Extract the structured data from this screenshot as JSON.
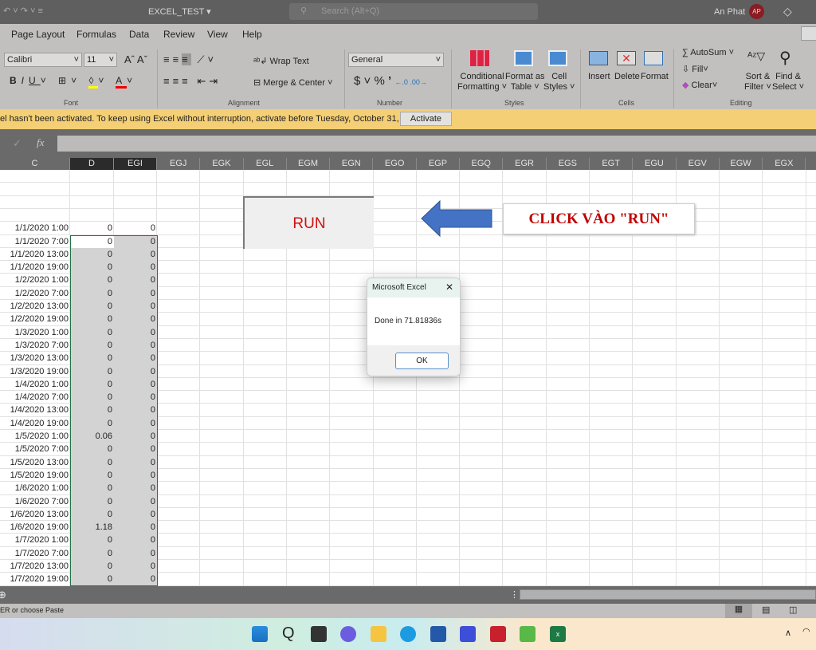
{
  "titlebar": {
    "filename": "EXCEL_TEST ▾",
    "search_placeholder": "Search (Alt+Q)",
    "user": "An Phat",
    "avatar": "AP"
  },
  "ribbon": {
    "tabs": [
      "Page Layout",
      "Formulas",
      "Data",
      "Review",
      "View",
      "Help"
    ],
    "font": {
      "name": "Calibri",
      "size": "11",
      "group": "Font"
    },
    "alignment": {
      "wrap": "Wrap Text",
      "merge": "Merge & Center",
      "group": "Alignment"
    },
    "number": {
      "format": "General",
      "group": "Number",
      "currency": "$",
      "percent": "%",
      "comma": "’"
    },
    "styles": {
      "conditional": [
        "Conditional",
        "Formatting ˅"
      ],
      "table": [
        "Format as",
        "Table ˅"
      ],
      "cell": [
        "Cell",
        "Styles ˅"
      ],
      "group": "Styles"
    },
    "cells": {
      "insert": "Insert",
      "delete": "Delete",
      "format": "Format",
      "group": "Cells"
    },
    "editing": {
      "autosum": "AutoSum",
      "fill": "Fill",
      "clear": "Clear",
      "sort": [
        "Sort &",
        "Filter ˅"
      ],
      "find": [
        "Find &",
        "Select ˅"
      ],
      "group": "Editing"
    }
  },
  "notice": {
    "text": "el hasn't been activated. To keep using Excel without interruption, activate before Tuesday, October 31, 2023.",
    "button": "Activate"
  },
  "formula_bar": {
    "fx": "fx",
    "check": "✓"
  },
  "columns": [
    "C",
    "D",
    "EGI",
    "EGJ",
    "EGK",
    "EGL",
    "EGM",
    "EGN",
    "EGO",
    "EGP",
    "EGQ",
    "EGR",
    "EGS",
    "EGT",
    "EGU",
    "EGV",
    "EGW",
    "EGX"
  ],
  "rows": [
    [
      "1/1/2020 1:00",
      "0",
      "0"
    ],
    [
      "1/1/2020 7:00",
      "0",
      "0"
    ],
    [
      "1/1/2020 13:00",
      "0",
      "0"
    ],
    [
      "1/1/2020 19:00",
      "0",
      "0"
    ],
    [
      "1/2/2020 1:00",
      "0",
      "0"
    ],
    [
      "1/2/2020 7:00",
      "0",
      "0"
    ],
    [
      "1/2/2020 13:00",
      "0",
      "0"
    ],
    [
      "1/2/2020 19:00",
      "0",
      "0"
    ],
    [
      "1/3/2020 1:00",
      "0",
      "0"
    ],
    [
      "1/3/2020 7:00",
      "0",
      "0"
    ],
    [
      "1/3/2020 13:00",
      "0",
      "0"
    ],
    [
      "1/3/2020 19:00",
      "0",
      "0"
    ],
    [
      "1/4/2020 1:00",
      "0",
      "0"
    ],
    [
      "1/4/2020 7:00",
      "0",
      "0"
    ],
    [
      "1/4/2020 13:00",
      "0",
      "0"
    ],
    [
      "1/4/2020 19:00",
      "0",
      "0"
    ],
    [
      "1/5/2020 1:00",
      "0.06",
      "0"
    ],
    [
      "1/5/2020 7:00",
      "0",
      "0"
    ],
    [
      "1/5/2020 13:00",
      "0",
      "0"
    ],
    [
      "1/5/2020 19:00",
      "0",
      "0"
    ],
    [
      "1/6/2020 1:00",
      "0",
      "0"
    ],
    [
      "1/6/2020 7:00",
      "0",
      "0"
    ],
    [
      "1/6/2020 13:00",
      "0",
      "0"
    ],
    [
      "1/6/2020 19:00",
      "1.18",
      "0"
    ],
    [
      "1/7/2020 1:00",
      "0",
      "0"
    ],
    [
      "1/7/2020 7:00",
      "0",
      "0"
    ],
    [
      "1/7/2020 13:00",
      "0",
      "0"
    ],
    [
      "1/7/2020 19:00",
      "0",
      "0"
    ]
  ],
  "run_button": "RUN",
  "callout": "CLICK VÀO \"RUN\"",
  "dialog": {
    "title": "Microsoft Excel",
    "message": "Done in 71.81836s",
    "ok": "OK",
    "close": "✕"
  },
  "status": {
    "text": "ER or choose Paste"
  },
  "colors": {
    "accent": "#217346",
    "run_text": "#d01010",
    "arrow": "#4472c4",
    "callout_text": "#c00000",
    "notice_bg": "#f4cf75"
  }
}
